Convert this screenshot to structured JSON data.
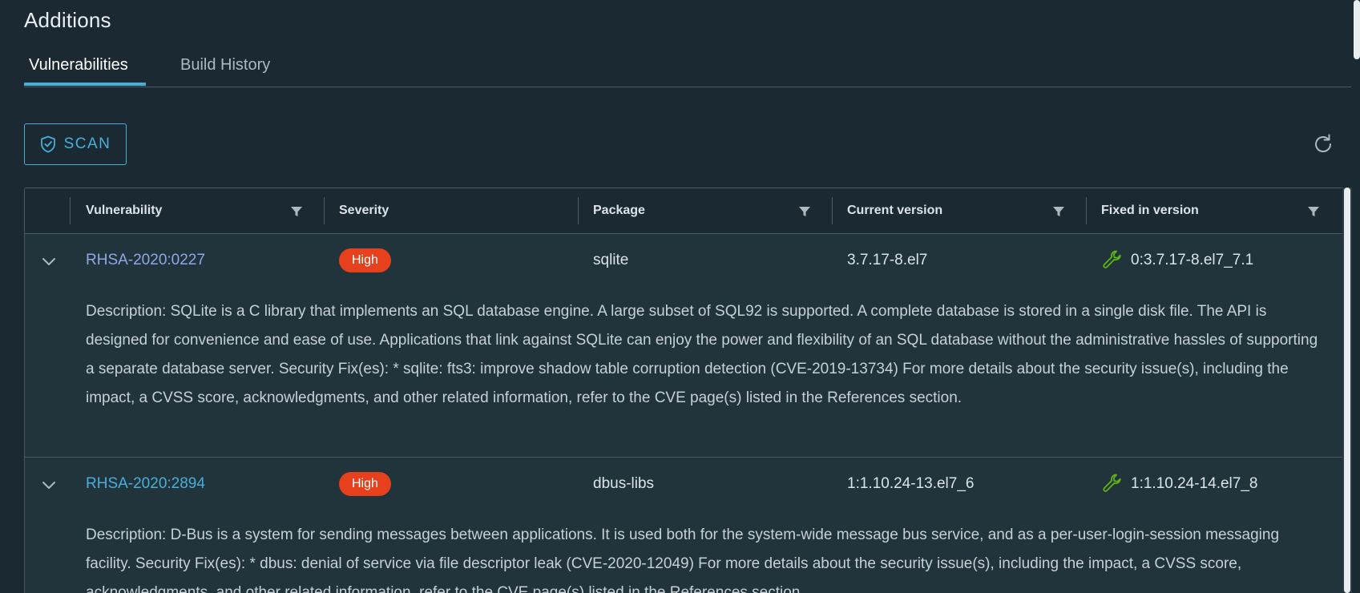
{
  "section": {
    "title": "Additions"
  },
  "tabs": [
    {
      "label": "Vulnerabilities",
      "active": true
    },
    {
      "label": "Build History",
      "active": false
    }
  ],
  "toolbar": {
    "scan_label": "SCAN",
    "scan_icon": "shield-check-icon",
    "refresh_icon": "refresh-icon"
  },
  "table": {
    "columns": [
      "Vulnerability",
      "Severity",
      "Package",
      "Current version",
      "Fixed in version"
    ],
    "rows": [
      {
        "vulnerability": "RHSA-2020:0227",
        "severity": "High",
        "package": "sqlite",
        "current_version": "3.7.17-8.el7",
        "fixed_version": "0:3.7.17-8.el7_7.1",
        "description": "Description: SQLite is a C library that implements an SQL database engine. A large subset of SQL92 is supported. A complete database is stored in a single disk file. The API is designed for convenience and ease of use. Applications that link against SQLite can enjoy the power and flexibility of an SQL database without the administrative hassles of supporting a separate database server. Security Fix(es): * sqlite: fts3: improve shadow table corruption detection (CVE-2019-13734) For more details about the security issue(s), including the impact, a CVSS score, acknowledgments, and other related information, refer to the CVE page(s) listed in the References section."
      },
      {
        "vulnerability": "RHSA-2020:2894",
        "severity": "High",
        "package": "dbus-libs",
        "current_version": "1:1.10.24-13.el7_6",
        "fixed_version": "1:1.10.24-14.el7_8",
        "description": "Description: D-Bus is a system for sending messages between applications. It is used both for the system-wide message bus service, and as a per-user-login-session messaging facility. Security Fix(es): * dbus: denial of service via file descriptor leak (CVE-2020-12049) For more details about the security issue(s), including the impact, a CVSS score, acknowledgments, and other related information, refer to the CVE page(s) listed in the References section."
      }
    ]
  },
  "colors": {
    "background": "#1b2a32",
    "accent": "#49afd9",
    "severity_high": "#e6401c",
    "fix_available": "#60b515"
  }
}
